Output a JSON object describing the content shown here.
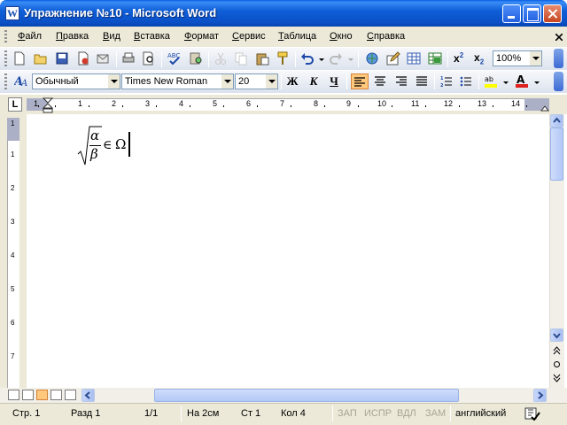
{
  "window": {
    "title": "Упражнение №10 - Microsoft Word"
  },
  "menu": [
    "Файл",
    "Правка",
    "Вид",
    "Вставка",
    "Формат",
    "Сервис",
    "Таблица",
    "Окно",
    "Справка"
  ],
  "toolbar": {
    "zoom": "100%",
    "icons": [
      "new-icon",
      "open-icon",
      "save-icon",
      "permission-icon",
      "email-icon",
      "print-icon",
      "print-preview-icon",
      "spelling-icon",
      "cut-icon",
      "copy-icon",
      "paste-icon",
      "format-painter-icon",
      "undo-icon",
      "redo-icon",
      "hyperlink-icon",
      "tables-borders-icon",
      "insert-table-icon",
      "insert-excel-icon",
      "superscript-icon",
      "subscript-icon"
    ]
  },
  "formatting": {
    "style": "Обычный",
    "font": "Times New Roman",
    "size": "20",
    "bold": "Ж",
    "italic": "К",
    "underline": "Ч"
  },
  "ruler": {
    "numbers": [
      "1",
      "1",
      "2",
      "3",
      "4",
      "5",
      "6",
      "7",
      "8",
      "9",
      "10",
      "11",
      "12",
      "13",
      "14"
    ],
    "vnumbers": [
      "1",
      "1",
      "2",
      "3",
      "4",
      "5",
      "6",
      "7"
    ]
  },
  "document": {
    "formula": {
      "numerator": "α",
      "denominator": "β",
      "operator": "∈",
      "set": "Ω"
    }
  },
  "status": {
    "page": "Стр. 1",
    "section": "Разд 1",
    "pages": "1/1",
    "at": "На 2см",
    "line": "Ст 1",
    "col": "Кол 4",
    "rec": "ЗАП",
    "trk": "ИСПР",
    "ext": "ВДЛ",
    "ovr": "ЗАМ",
    "language": "английский"
  },
  "colors": {
    "accent": "#0a5ee0",
    "active_button": "#ffc87c"
  }
}
